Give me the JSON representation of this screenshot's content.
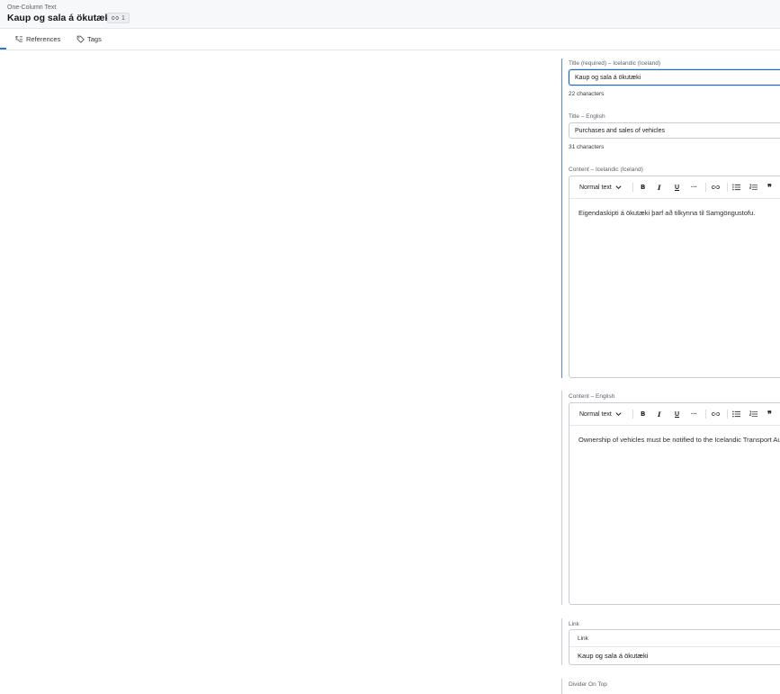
{
  "header": {
    "content_type": "One-Column Text",
    "title": "Kaup og sala á ökutæki",
    "reference_count": "1",
    "link_icon": "link-icon"
  },
  "tabs": [
    {
      "label": "References",
      "icon": "references-icon",
      "active": true
    },
    {
      "label": "Tags",
      "icon": "tag-icon",
      "active": false
    }
  ],
  "fields": {
    "title_is": {
      "label": "Title (required) – Icelandic (Iceland)",
      "value": "Kaup og sala á ökutæki",
      "char_count": "22 characters"
    },
    "title_en": {
      "label": "Title – English",
      "value": "Purchases and sales of vehicles",
      "char_count": "31 characters"
    },
    "content_is": {
      "label": "Content – Icelandic (Iceland)",
      "text": "Eigendaskipti á ökutæki þarf að tilkynna til Samgöngustofu."
    },
    "content_en": {
      "label": "Content – English",
      "text": "Ownership of vehicles must be notified to the Icelandic Transport Authority."
    },
    "link": {
      "label": "Link",
      "sublabel": "Link",
      "value": "Kaup og sala á ökutæki"
    },
    "divider": {
      "label": "Divider On Top"
    }
  },
  "toolbar": {
    "format_label": "Normal text",
    "bold": "B",
    "italic": "I",
    "underline": "U",
    "more": "···",
    "quote": "❞"
  },
  "colors": {
    "accent": "#1f63c5",
    "group_bar": "#5b86c5",
    "border": "#c9ccd2"
  }
}
